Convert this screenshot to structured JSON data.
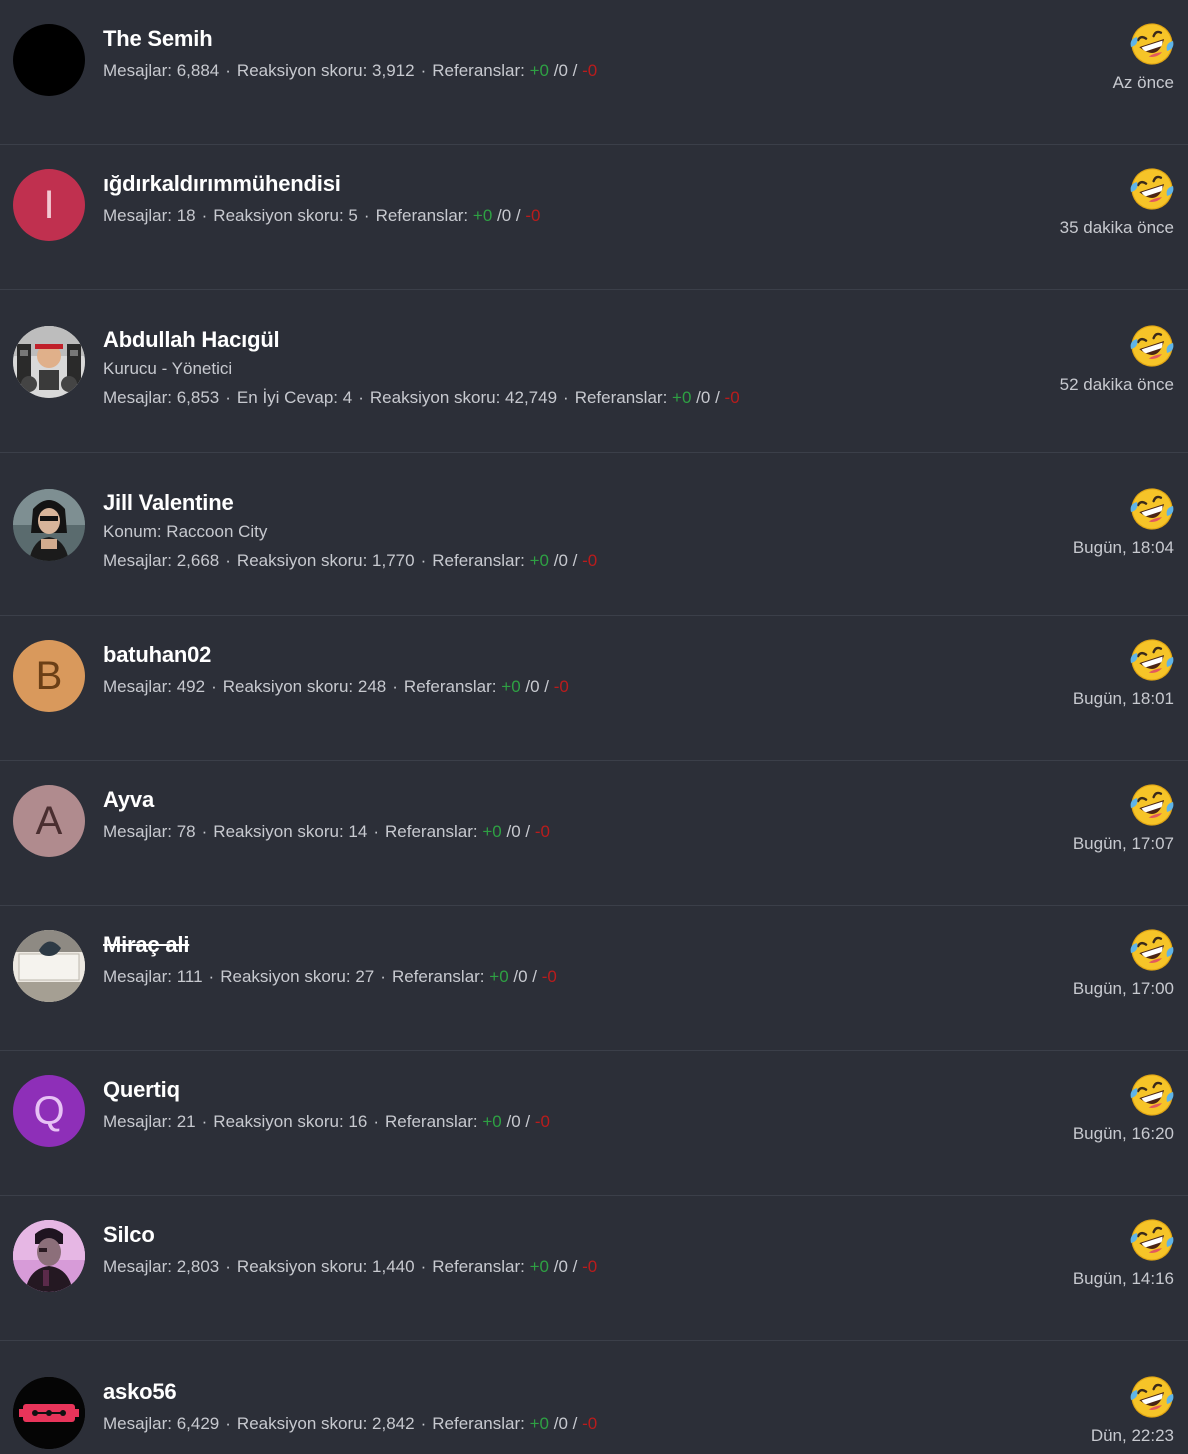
{
  "colors": {
    "background": "#2c2f38",
    "positive": "#2ea043",
    "negative": "#b91c1c"
  },
  "reaction_icon": "laughing-tears-emoji-icon",
  "labels": {
    "messages": "Mesajlar:",
    "reaction_score": "Reaksiyon skoru:",
    "references": "Referanslar:",
    "best_answer": "En İyi Cevap:"
  },
  "rows": [
    {
      "name": "The Semih",
      "avatar": {
        "type": "solid",
        "color": "#000000",
        "letter": ""
      },
      "subtitle": "",
      "messages": "6,884",
      "best_answer": "",
      "reaction_score": "3,912",
      "ref_pos": "+0",
      "ref_neu": "/0 /",
      "ref_neg": "-0",
      "time": "Az önce"
    },
    {
      "name": "ığdırkaldırımmühendisi",
      "avatar": {
        "type": "letter",
        "color": "#c0304f",
        "text_color": "#f2c9d2",
        "letter": "I"
      },
      "subtitle": "",
      "messages": "18",
      "best_answer": "",
      "reaction_score": "5",
      "ref_pos": "+0",
      "ref_neu": "/0 /",
      "ref_neg": "-0",
      "time": "35 dakika önce"
    },
    {
      "name": "Abdullah Hacıgül",
      "avatar": {
        "type": "photo",
        "color": "#6a6a6a",
        "letter": ""
      },
      "subtitle": "Kurucu - Yönetici",
      "messages": "6,853",
      "best_answer": "4",
      "reaction_score": "42,749",
      "ref_pos": "+0",
      "ref_neu": "/0 /",
      "ref_neg": "-0",
      "time": "52 dakika önce"
    },
    {
      "name": "Jill Valentine",
      "avatar": {
        "type": "photo",
        "color": "#3e4a4f",
        "letter": ""
      },
      "subtitle": "Konum: Raccoon City",
      "messages": "2,668",
      "best_answer": "",
      "reaction_score": "1,770",
      "ref_pos": "+0",
      "ref_neu": "/0 /",
      "ref_neg": "-0",
      "time": "Bugün, 18:04"
    },
    {
      "name": "batuhan02",
      "avatar": {
        "type": "letter",
        "color": "#d9995c",
        "text_color": "#6b3f16",
        "letter": "B"
      },
      "subtitle": "",
      "messages": "492",
      "best_answer": "",
      "reaction_score": "248",
      "ref_pos": "+0",
      "ref_neu": "/0 /",
      "ref_neg": "-0",
      "time": "Bugün, 18:01"
    },
    {
      "name": "Ayva",
      "avatar": {
        "type": "letter",
        "color": "#b08b8e",
        "text_color": "#4a2e30",
        "letter": "A"
      },
      "subtitle": "",
      "messages": "78",
      "best_answer": "",
      "reaction_score": "14",
      "ref_pos": "+0",
      "ref_neu": "/0 /",
      "ref_neg": "-0",
      "time": "Bugün, 17:07"
    },
    {
      "name": "Miraç ali",
      "avatar": {
        "type": "photo",
        "color": "#b9b3a8",
        "letter": ""
      },
      "subtitle": "",
      "messages": "111",
      "best_answer": "",
      "reaction_score": "27",
      "ref_pos": "+0",
      "ref_neu": "/0 /",
      "ref_neg": "-0",
      "time": "Bugün, 17:00"
    },
    {
      "name": "Quertiq",
      "avatar": {
        "type": "letter",
        "color": "#8e2fb8",
        "text_color": "#e7c2f5",
        "letter": "Q"
      },
      "subtitle": "",
      "messages": "21",
      "best_answer": "",
      "reaction_score": "16",
      "ref_pos": "+0",
      "ref_neu": "/0 /",
      "ref_neg": "-0",
      "time": "Bugün, 16:20"
    },
    {
      "name": "Silco",
      "avatar": {
        "type": "photo",
        "color": "#c98acb",
        "letter": ""
      },
      "subtitle": "",
      "messages": "2,803",
      "best_answer": "",
      "reaction_score": "1,440",
      "ref_pos": "+0",
      "ref_neu": "/0 /",
      "ref_neg": "-0",
      "time": "Bugün, 14:16"
    },
    {
      "name": "asko56",
      "avatar": {
        "type": "photo",
        "color": "#000000",
        "letter": ""
      },
      "subtitle": "",
      "messages": "6,429",
      "best_answer": "",
      "reaction_score": "2,842",
      "ref_pos": "+0",
      "ref_neu": "/0 /",
      "ref_neg": "-0",
      "time": "Dün, 22:23"
    }
  ]
}
